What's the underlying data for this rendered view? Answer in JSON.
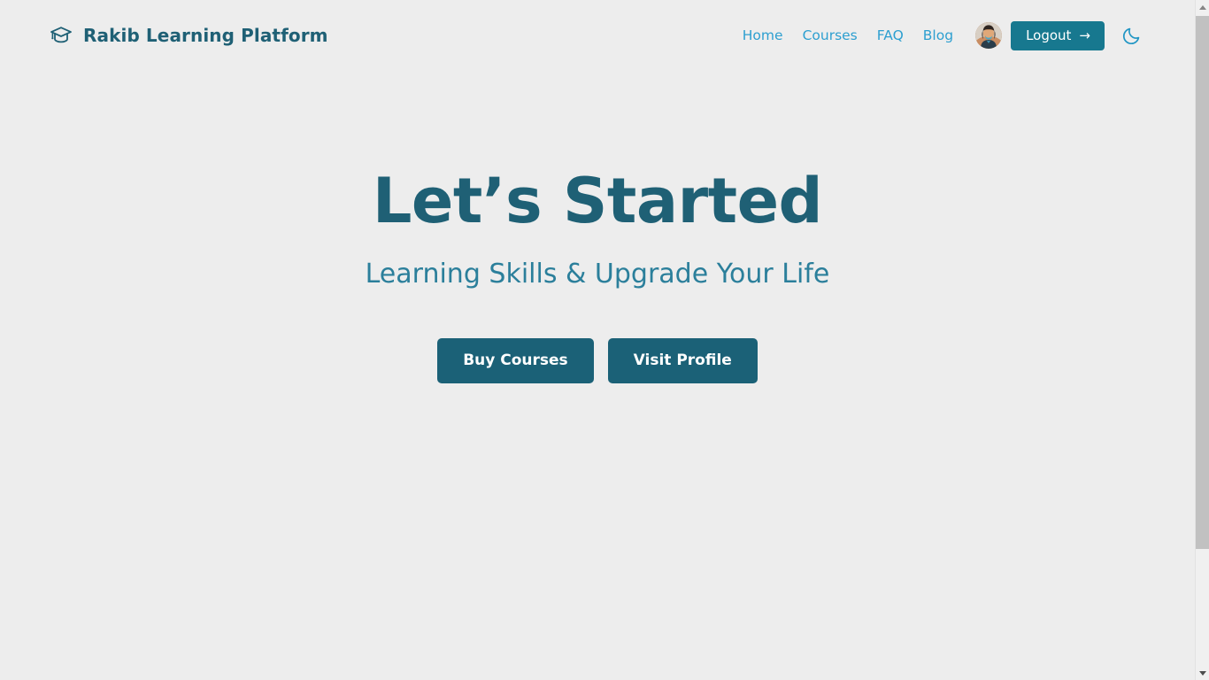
{
  "theme": {
    "page_background": "#ededed",
    "brand_dark_teal": "#1f6075",
    "nav_link_blue": "#2d9fd0",
    "logout_teal": "#17788f",
    "cta_teal": "#1b6177",
    "subtitle_teal": "#2b7f9b",
    "moon_blue": "#2196c4"
  },
  "header": {
    "brand": {
      "icon": "graduation-cap-icon",
      "name": "Rakib Learning Platform"
    },
    "nav_links": [
      {
        "label": "Home"
      },
      {
        "label": "Courses"
      },
      {
        "label": "FAQ"
      },
      {
        "label": "Blog"
      }
    ],
    "avatar": {
      "icon": "user-avatar-photo",
      "alt": "User profile photo"
    },
    "logout_button": {
      "label": "Logout",
      "arrow": "→",
      "icon": "arrow-right-icon"
    },
    "theme_toggle": {
      "icon": "moon-icon",
      "label": "Dark mode"
    }
  },
  "hero": {
    "title": "Let’s Started",
    "subtitle": "Learning Skills & Upgrade Your Life",
    "buttons": [
      {
        "label": "Buy Courses",
        "name": "buy-courses-button"
      },
      {
        "label": "Visit Profile",
        "name": "visit-profile-button"
      }
    ]
  },
  "scrollbar": {
    "up_arrow": "▲",
    "down_arrow": "▼"
  }
}
